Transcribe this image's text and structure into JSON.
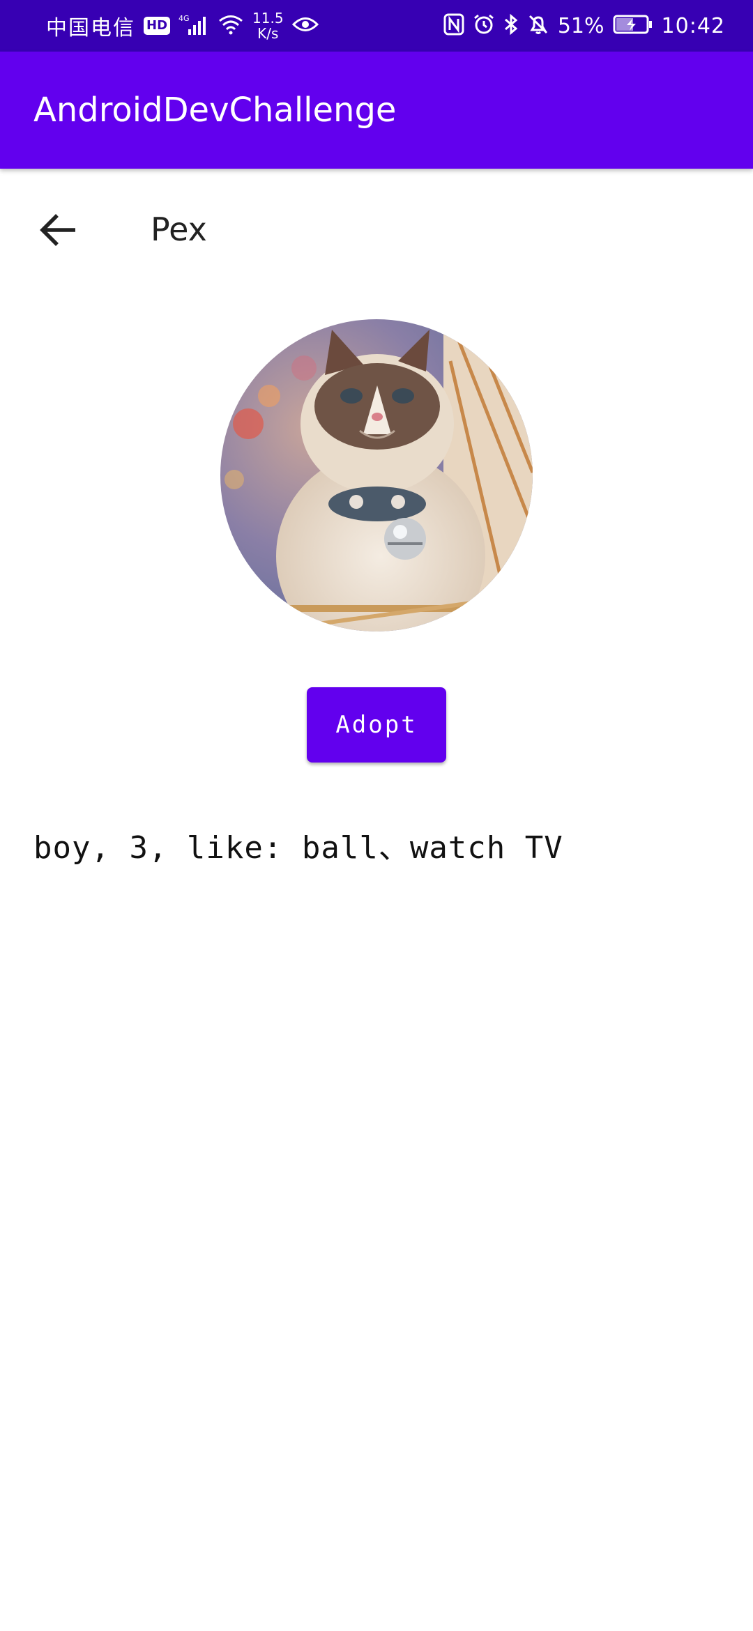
{
  "status_bar": {
    "carrier": "中国电信",
    "hd_badge": "HD",
    "network_type": "4G",
    "speed_value": "11.5",
    "speed_unit": "K/s",
    "battery_percent": "51%",
    "time": "10:42"
  },
  "app_bar": {
    "title": "AndroidDevChallenge"
  },
  "detail": {
    "pet_name": "Pex",
    "adopt_label": "Adopt",
    "description": "boy, 3, like: ball、watch TV"
  },
  "colors": {
    "status_bar": "#3700b3",
    "primary": "#6200ee"
  }
}
